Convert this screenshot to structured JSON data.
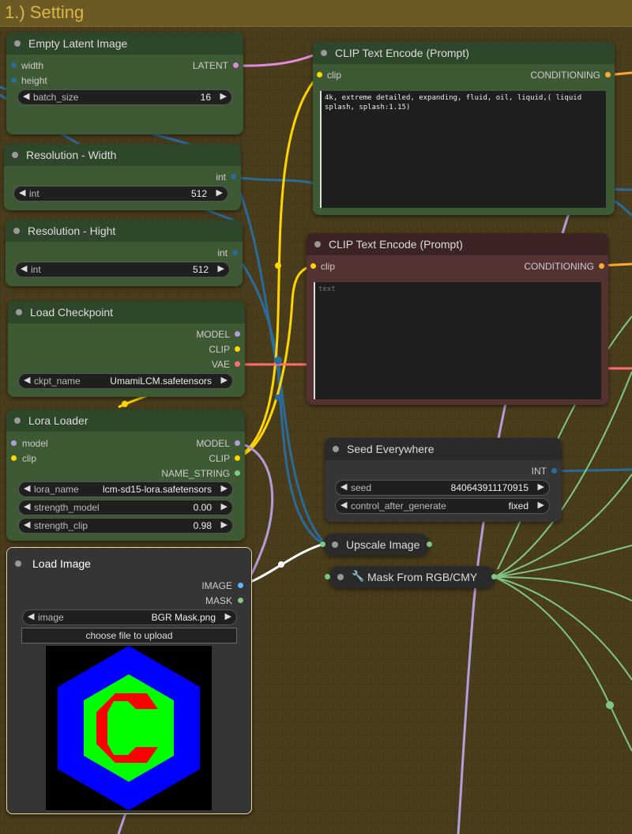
{
  "group": {
    "title": "1.) Setting"
  },
  "colors": {
    "background": "#4a3d1c",
    "model_wire": "#b39ddb",
    "clip_wire": "#ffd500",
    "int_wire": "#2a6b9c",
    "conditioning_wire": "#ffa931",
    "vae_wire": "#ff6e6e",
    "image_wire": "#64b5f6",
    "mask_wire": "#81c784"
  },
  "nodes": {
    "empty_latent": {
      "title": "Empty Latent Image",
      "inputs": [
        "width",
        "height"
      ],
      "output": "LATENT",
      "widget": {
        "label": "batch_size",
        "value": "16"
      }
    },
    "res_width": {
      "title": "Resolution - Width",
      "output": "int",
      "widget": {
        "label": "int",
        "value": "512"
      }
    },
    "res_hight": {
      "title": "Resolution - Hight",
      "output": "int",
      "widget": {
        "label": "int",
        "value": "512"
      }
    },
    "load_checkpoint": {
      "title": "Load Checkpoint",
      "outputs": [
        "MODEL",
        "CLIP",
        "VAE"
      ],
      "widget": {
        "label": "ckpt_name",
        "value": "UmamiLCM.safetensors"
      }
    },
    "lora_loader": {
      "title": "Lora Loader",
      "inputs": [
        "model",
        "clip"
      ],
      "outputs": [
        "MODEL",
        "CLIP",
        "NAME_STRING"
      ],
      "widgets": [
        {
          "label": "lora_name",
          "value": "lcm-sd15-lora.safetensors"
        },
        {
          "label": "strength_model",
          "value": "0.00"
        },
        {
          "label": "strength_clip",
          "value": "0.98"
        }
      ]
    },
    "load_image": {
      "title": "Load Image",
      "outputs": [
        "IMAGE",
        "MASK"
      ],
      "widget": {
        "label": "image",
        "value": "BGR Mask.png"
      },
      "upload_button": "choose file to upload",
      "preview": {
        "outer": "#0000ff",
        "middle": "#00ff00",
        "inner": "#ff0000",
        "bg": "#000000"
      }
    },
    "clip_pos": {
      "title": "CLIP Text Encode (Prompt)",
      "input": "clip",
      "output": "CONDITIONING",
      "text": "4k, extreme detailed, expanding, fluid, oil, liquid,( liquid splash, splash:1.15)"
    },
    "clip_neg": {
      "title": "CLIP Text Encode (Prompt)",
      "input": "clip",
      "output": "CONDITIONING",
      "placeholder": "text"
    },
    "seed_everywhere": {
      "title": "Seed Everywhere",
      "output": "INT",
      "widgets": [
        {
          "label": "seed",
          "value": "840643911170915"
        },
        {
          "label": "control_after_generate",
          "value": "fixed"
        }
      ]
    },
    "upscale_image": {
      "title": "Upscale Image"
    },
    "mask_rgb": {
      "title": "Mask From RGB/CMY",
      "icon": "wrench-icon"
    }
  }
}
